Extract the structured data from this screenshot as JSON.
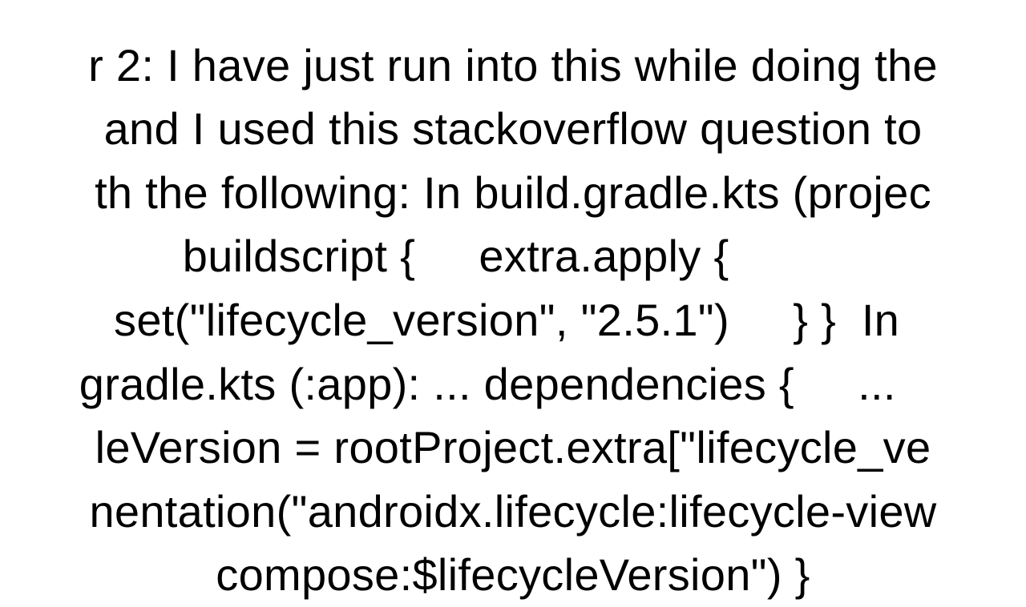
{
  "content": {
    "line1": "r 2: I have just run into this while doing the",
    "line2": " and I used this stackoverflow question to ",
    "line3": "th the following: In build.gradle.kts (projec",
    "line4": "buildscript {     extra.apply {         ",
    "line5": "set(\"lifecycle_version\", \"2.5.1\")     } }  In ",
    "line6": "gradle.kts (:app): ... dependencies {     ...    ",
    "line7": "leVersion = rootProject.extra[\"lifecycle_ve",
    "line8": "nentation(\"androidx.lifecycle:lifecycle-view",
    "line9": "compose:$lifecycleVersion\") }"
  }
}
